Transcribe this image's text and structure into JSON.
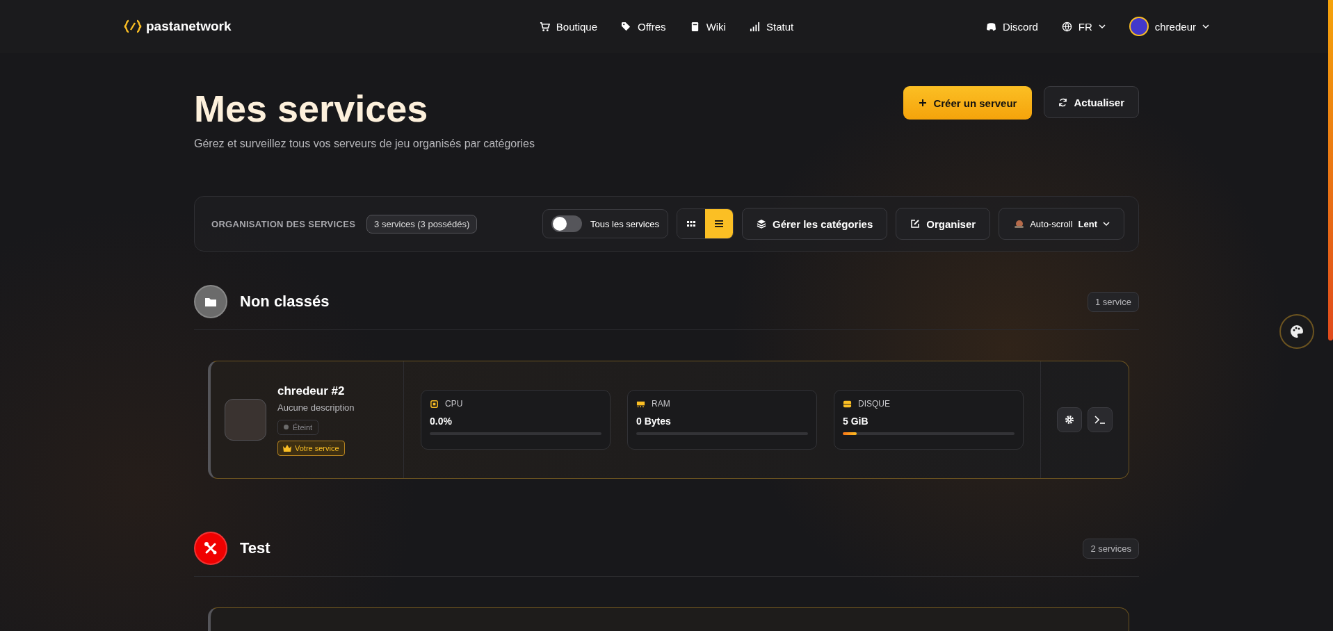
{
  "header": {
    "logo": "pastanetwork",
    "nav": [
      {
        "label": "Boutique",
        "kind": "cart"
      },
      {
        "label": "Offres",
        "kind": "tag"
      },
      {
        "label": "Wiki",
        "kind": "book"
      },
      {
        "label": "Statut",
        "kind": "signal"
      }
    ],
    "discord": "Discord",
    "language": "FR",
    "user": "chredeur"
  },
  "page": {
    "title": "Mes services",
    "subtitle": "Gérez et surveillez tous vos serveurs de jeu organisés par catégories",
    "create_button": "Créer un serveur",
    "refresh_button": "Actualiser"
  },
  "toolbar": {
    "label": "ORGANISATION DES SERVICES",
    "count": "3 services (3 possédés)",
    "toggle": {
      "label": "Tous les services",
      "on": false
    },
    "views": [
      {
        "kind": "grid",
        "selected": false
      },
      {
        "kind": "list",
        "selected": true
      }
    ],
    "manage_button": "Gérer les catégories",
    "organize_button": "Organiser",
    "autoscroll": {
      "label": "Auto-scroll",
      "value": "Lent"
    }
  },
  "sections": [
    {
      "name": "Non classés",
      "kind": "folder",
      "color": "#6b6b6b",
      "count": "1 service",
      "services": [
        {
          "name": "chredeur #2",
          "description": "Aucune description",
          "status": {
            "label": "Éteint",
            "on": false
          },
          "badge": "Votre service",
          "metrics": [
            {
              "label": "CPU",
              "kind": "cpu",
              "reading": "0.0%",
              "level": 0
            },
            {
              "label": "RAM",
              "kind": "ram",
              "reading": "0 Bytes",
              "level": 0
            },
            {
              "label": "DISQUE",
              "kind": "disk",
              "reading": "5 GiB",
              "level": 0.08
            }
          ]
        }
      ]
    },
    {
      "name": "Test",
      "kind": "tools",
      "color": "#f00000",
      "count": "2 services"
    }
  ]
}
